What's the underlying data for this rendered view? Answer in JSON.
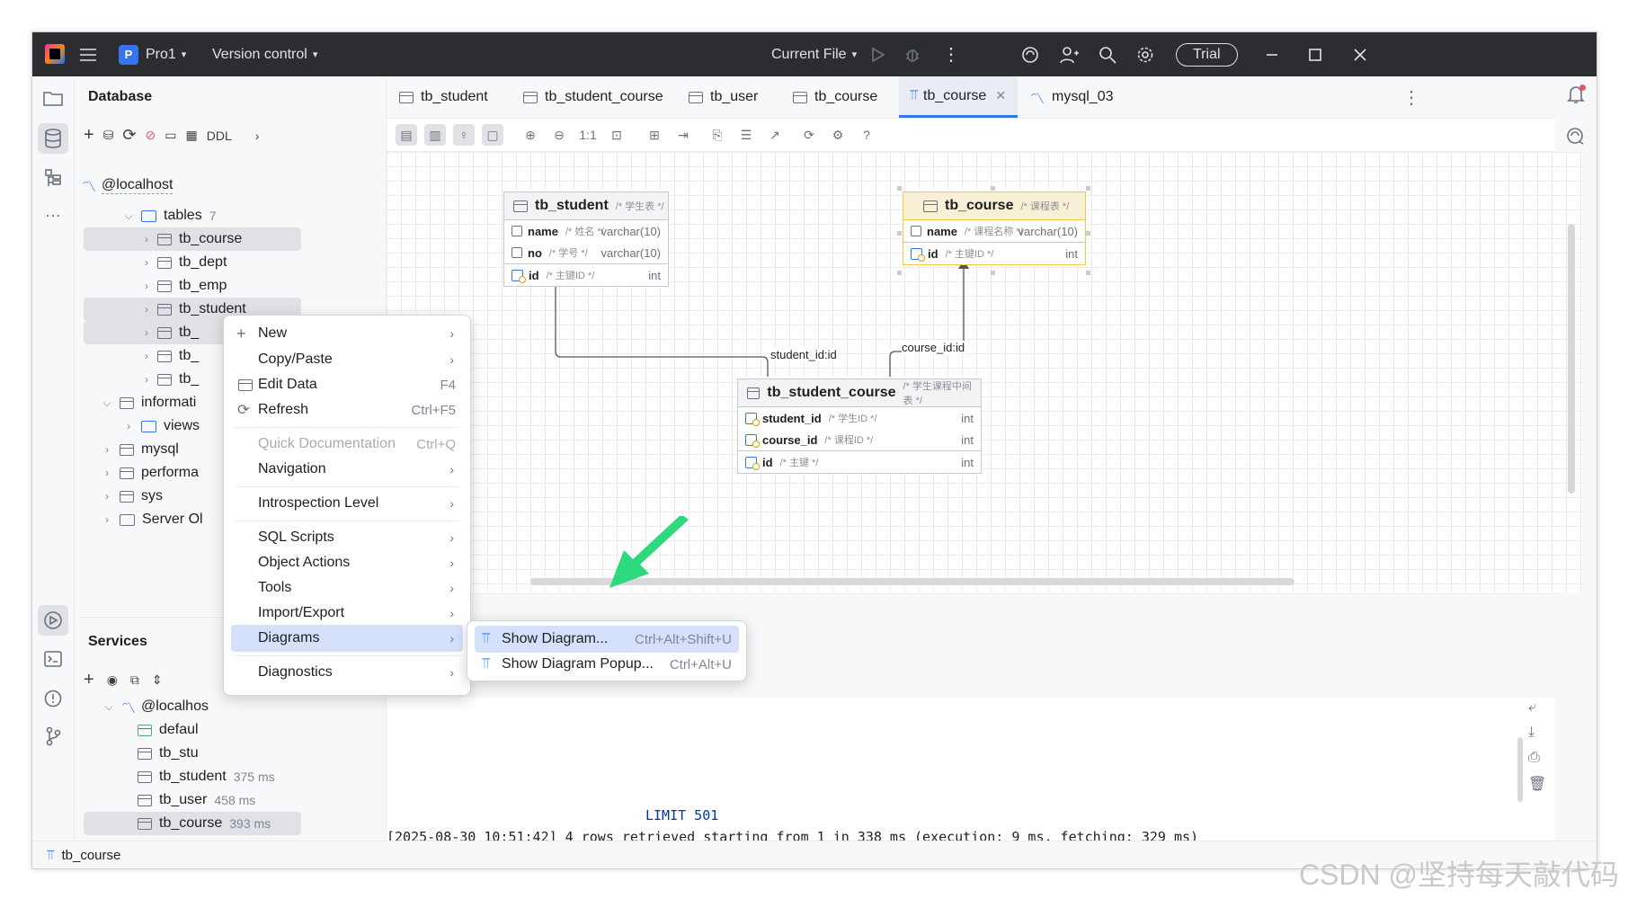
{
  "titlebar": {
    "project_initial": "P",
    "project_name": "Pro1",
    "vcs": "Version control",
    "run_config": "Current File",
    "trial": "Trial"
  },
  "db_panel": {
    "title": "Database",
    "ddl": "DDL",
    "host": "@localhost",
    "tables_label": "tables",
    "tables_count": "7",
    "tree": [
      "tb_course",
      "tb_dept",
      "tb_emp",
      "tb_student",
      "tb_",
      "tb_",
      "tb_"
    ],
    "informati": "informati",
    "views": "views",
    "mysql": "mysql",
    "performa": "performa",
    "sys": "sys",
    "server": "Server Ol"
  },
  "services_panel": {
    "title": "Services",
    "host": "@localhos",
    "items": [
      {
        "name": "defaul",
        "time": ""
      },
      {
        "name": "tb_stu",
        "time": ""
      },
      {
        "name": "tb_student",
        "time": "375 ms"
      },
      {
        "name": "tb_user",
        "time": "458 ms"
      },
      {
        "name": "tb_course",
        "time": "393 ms"
      }
    ]
  },
  "tabs": [
    "tb_student",
    "tb_student_course",
    "tb_user",
    "tb_course",
    "tb_course",
    "mysql_03"
  ],
  "diagram_toolbar": {
    "one_to_one": "1:1",
    "help": "?"
  },
  "entities": {
    "tb_student": {
      "name": "tb_student",
      "comment": "/* 学生表 */",
      "columns": [
        {
          "name": "name",
          "comment": "/* 姓名 */",
          "type": "varchar(10)"
        },
        {
          "name": "no",
          "comment": "/* 学号 */",
          "type": "varchar(10)"
        },
        {
          "name": "id",
          "comment": "/* 主键ID */",
          "type": "int"
        }
      ]
    },
    "tb_course": {
      "name": "tb_course",
      "comment": "/* 课程表 */",
      "columns": [
        {
          "name": "name",
          "comment": "/* 课程名称 */",
          "type": "varchar(10)"
        },
        {
          "name": "id",
          "comment": "/* 主键ID */",
          "type": "int"
        }
      ]
    },
    "tb_student_course": {
      "name": "tb_student_course",
      "comment": "/* 学生课程中间表 */",
      "columns": [
        {
          "name": "student_id",
          "comment": "/* 学生ID */",
          "type": "int"
        },
        {
          "name": "course_id",
          "comment": "/* 课程ID */",
          "type": "int"
        },
        {
          "name": "id",
          "comment": "/* 主键 */",
          "type": "int"
        }
      ]
    }
  },
  "relations": {
    "student": "student_id:id",
    "course": "course_id:id"
  },
  "context_menu": [
    {
      "label": "New",
      "shortcut": "",
      "submenu": true
    },
    {
      "label": "Copy/Paste",
      "shortcut": "",
      "submenu": true
    },
    {
      "label": "Edit Data",
      "shortcut": "F4",
      "submenu": false
    },
    {
      "label": "Refresh",
      "shortcut": "Ctrl+F5",
      "submenu": false
    },
    {
      "label": "Quick Documentation",
      "shortcut": "Ctrl+Q",
      "submenu": false
    },
    {
      "label": "Navigation",
      "shortcut": "",
      "submenu": true
    },
    {
      "label": "Introspection Level",
      "shortcut": "",
      "submenu": true
    },
    {
      "label": "SQL Scripts",
      "shortcut": "",
      "submenu": true
    },
    {
      "label": "Object Actions",
      "shortcut": "",
      "submenu": true
    },
    {
      "label": "Tools",
      "shortcut": "",
      "submenu": true
    },
    {
      "label": "Import/Export",
      "shortcut": "",
      "submenu": true
    },
    {
      "label": "Diagrams",
      "shortcut": "",
      "submenu": true
    },
    {
      "label": "Diagnostics",
      "shortcut": "",
      "submenu": true
    }
  ],
  "submenu": [
    {
      "label": "Show Diagram...",
      "shortcut": "Ctrl+Alt+Shift+U"
    },
    {
      "label": "Show Diagram Popup...",
      "shortcut": "Ctrl+Alt+U"
    }
  ],
  "console": {
    "limit": "LIMIT 501",
    "log": "[2025-08-30 10:51:42] 4 rows retrieved starting from 1 in 338 ms (execution: 9 ms, fetching: 329 ms)"
  },
  "statusbar": {
    "crumb": "tb_course"
  },
  "watermark": "CSDN @坚持每天敲代码",
  "colors": {
    "accent": "#3574f0",
    "selection_yellow": "#f2c94c",
    "arrow_green": "#2ed87e"
  }
}
